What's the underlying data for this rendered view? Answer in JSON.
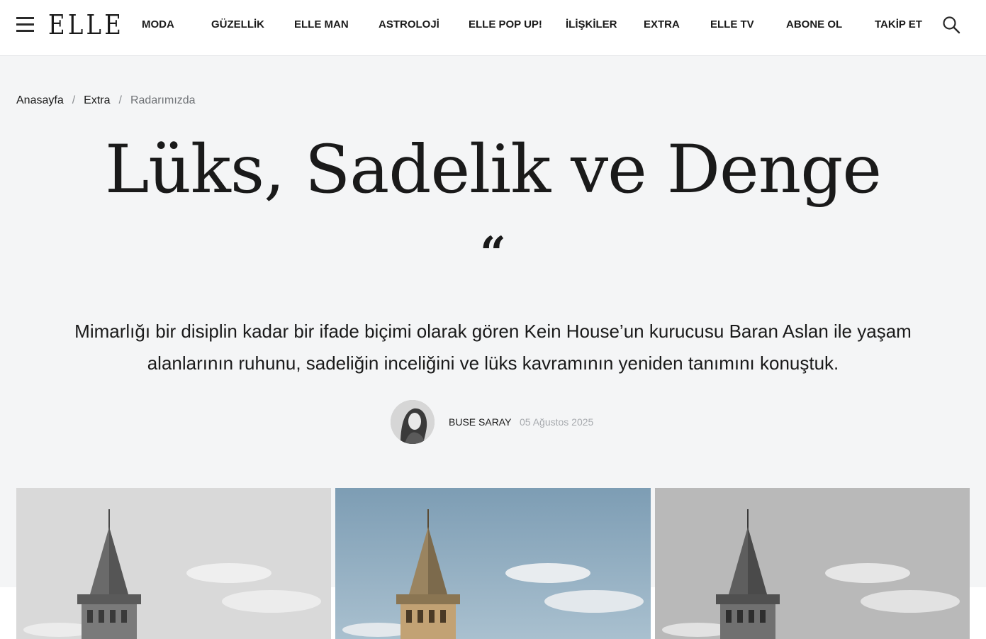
{
  "header": {
    "logo": "ELLE",
    "nav": [
      {
        "label": "MODA"
      },
      {
        "label": "GÜZELLİK"
      },
      {
        "label": "ELLE MAN"
      },
      {
        "label": "ASTROLOJİ"
      },
      {
        "label": "ELLE POP UP!"
      },
      {
        "label": "İLİŞKİLER"
      },
      {
        "label": "EXTRA"
      },
      {
        "label": "ELLE TV"
      },
      {
        "label": "ABONE OL"
      },
      {
        "label": "TAKİP ET"
      }
    ],
    "icons": {
      "menu": "hamburger-menu-icon",
      "search": "search-icon"
    }
  },
  "breadcrumb": {
    "items": [
      "Anasayfa",
      "Extra",
      "Radarımızda"
    ],
    "separator": "/"
  },
  "article": {
    "title": "Lüks, Sadelik ve Denge",
    "quote_mark": "“",
    "lead": "Mimarlığı bir disiplin kadar bir ifade biçimi olarak gören Kein House’un kurucusu Baran Aslan ile yaşam alanlarının ruhunu, sadeliğin inceliğini ve lüks kavramının yeniden tanımını konuştuk.",
    "author": "BUSE SARAY",
    "date": "05 Ağustos 2025"
  },
  "gallery": {
    "images": [
      {
        "subject": "galata-tower",
        "style": "grayscale"
      },
      {
        "subject": "galata-tower",
        "style": "color"
      },
      {
        "subject": "galata-tower",
        "style": "grayscale"
      }
    ]
  },
  "colors": {
    "background": "#f4f5f6",
    "header_bg": "#ffffff",
    "text": "#1a1a1a",
    "muted": "#a7aaae"
  }
}
